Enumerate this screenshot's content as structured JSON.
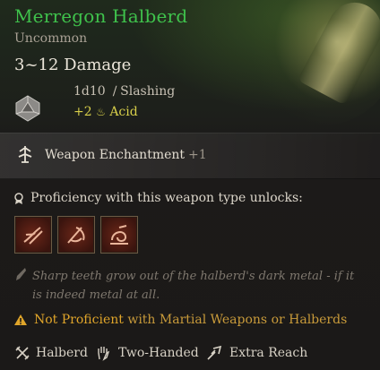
{
  "item": {
    "name": "Merregon Halberd",
    "rarity": "Uncommon",
    "damage_range": "3~12 Damage",
    "base_dice": "1d10",
    "damage_type": "Slashing",
    "bonus_damage": "+2",
    "bonus_type": "Acid"
  },
  "enchantment": {
    "label": "Weapon Enchantment",
    "value": "+1"
  },
  "proficiency": {
    "label": "Proficiency with this weapon type unlocks:",
    "actions": [
      "lacerate-action-icon",
      "cleave-action-icon",
      "topple-action-icon"
    ]
  },
  "flavor": "Sharp teeth grow out of the halberd's dark metal - if it is indeed metal at all.",
  "warning": {
    "prefix": "Not Proficient",
    "rest": "with Martial Weapons or Halberds"
  },
  "properties": [
    {
      "label": "Halberd",
      "icon": "halberd-icon"
    },
    {
      "label": "Two-Handed",
      "icon": "hand-icon"
    },
    {
      "label": "Extra Reach",
      "icon": "reach-icon"
    }
  ],
  "colors": {
    "title": "#3fc24c",
    "bonus": "#d8cf4a",
    "warning": "#e0a52a",
    "action_bg": "#6a2618"
  }
}
